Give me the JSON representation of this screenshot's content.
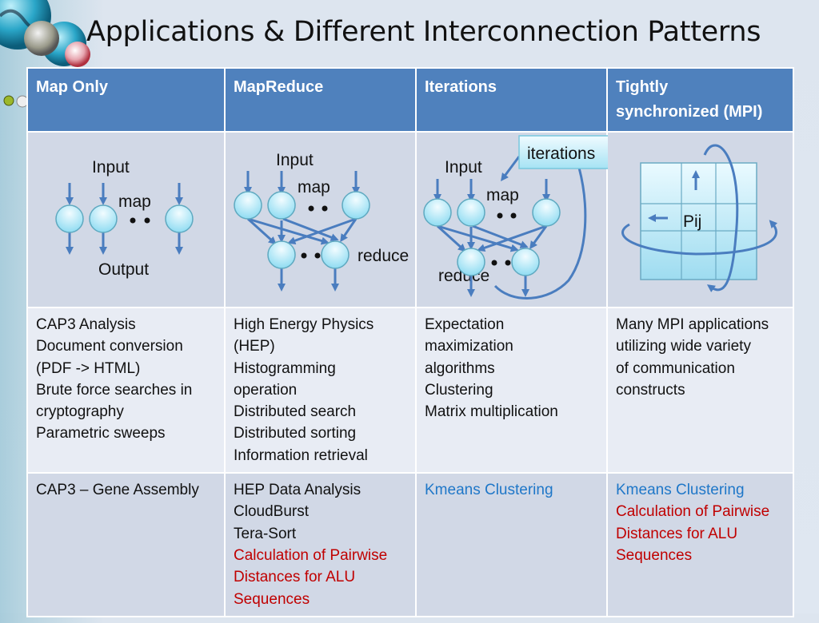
{
  "slide": {
    "title": "Applications & Different Interconnection Patterns"
  },
  "table": {
    "headers": [
      {
        "line1": "Map Only",
        "line2": ""
      },
      {
        "line1": "MapReduce",
        "line2": ""
      },
      {
        "line1": "Iterations",
        "line2": ""
      },
      {
        "line1": "Tightly",
        "line2": "synchronized (MPI)"
      }
    ],
    "diagrams": {
      "map_only": {
        "input": "Input",
        "map": "map",
        "output": "Output"
      },
      "mapreduce": {
        "input": "Input",
        "map": "map",
        "reduce": "reduce"
      },
      "iterations": {
        "input": "Input",
        "map": "map",
        "reduce": "reduce",
        "callout": "iterations"
      },
      "mpi": {
        "cell_label": "Pij"
      }
    },
    "applications": [
      {
        "lines": [
          {
            "text": "CAP3 Analysis",
            "color": "black"
          },
          {
            "text": "Document conversion",
            "color": "black"
          },
          {
            "text": "(PDF -> HTML)",
            "color": "black"
          },
          {
            "text": "Brute force searches in",
            "color": "black"
          },
          {
            "text": "cryptography",
            "color": "black"
          },
          {
            "text": "Parametric sweeps",
            "color": "black"
          }
        ]
      },
      {
        "lines": [
          {
            "text": "High Energy Physics",
            "color": "black"
          },
          {
            "text": "(HEP)",
            "color": "black"
          },
          {
            "text": "Histogramming",
            "color": "black"
          },
          {
            "text": "operation",
            "color": "black"
          },
          {
            "text": "Distributed search",
            "color": "black"
          },
          {
            "text": "Distributed sorting",
            "color": "black"
          },
          {
            "text": "Information retrieval",
            "color": "black"
          }
        ]
      },
      {
        "lines": [
          {
            "text": "Expectation",
            "color": "black"
          },
          {
            "text": "maximization",
            "color": "black"
          },
          {
            "text": "algorithms",
            "color": "black"
          },
          {
            "text": "Clustering",
            "color": "black"
          },
          {
            "text": "Matrix multiplication",
            "color": "black"
          }
        ]
      },
      {
        "lines": [
          {
            "text": "Many MPI applications",
            "color": "black"
          },
          {
            "text": "utilizing wide variety",
            "color": "black"
          },
          {
            "text": "of communication",
            "color": "black"
          },
          {
            "text": "constructs",
            "color": "black"
          }
        ]
      }
    ],
    "examples": [
      {
        "lines": [
          {
            "text": "CAP3 – Gene Assembly",
            "color": "black"
          }
        ]
      },
      {
        "lines": [
          {
            "text": "HEP Data Analysis",
            "color": "black"
          },
          {
            "text": "CloudBurst",
            "color": "black"
          },
          {
            "text": "Tera-Sort",
            "color": "black"
          },
          {
            "text": "Calculation of Pairwise",
            "color": "red"
          },
          {
            "text": "Distances for ALU",
            "color": "red"
          },
          {
            "text": "Sequences",
            "color": "red"
          }
        ]
      },
      {
        "lines": [
          {
            "text": "Kmeans Clustering",
            "color": "blue"
          }
        ]
      },
      {
        "lines": [
          {
            "text": "Kmeans Clustering",
            "color": "blue"
          },
          {
            "text": "Calculation of Pairwise",
            "color": "red"
          },
          {
            "text": "Distances for ALU",
            "color": "red"
          },
          {
            "text": "Sequences",
            "color": "red"
          }
        ]
      }
    ]
  },
  "colors": {
    "header_bg": "#4f81bd",
    "arrow": "#4a7dbf",
    "red_text": "#c00000",
    "blue_text": "#1f77c8"
  }
}
